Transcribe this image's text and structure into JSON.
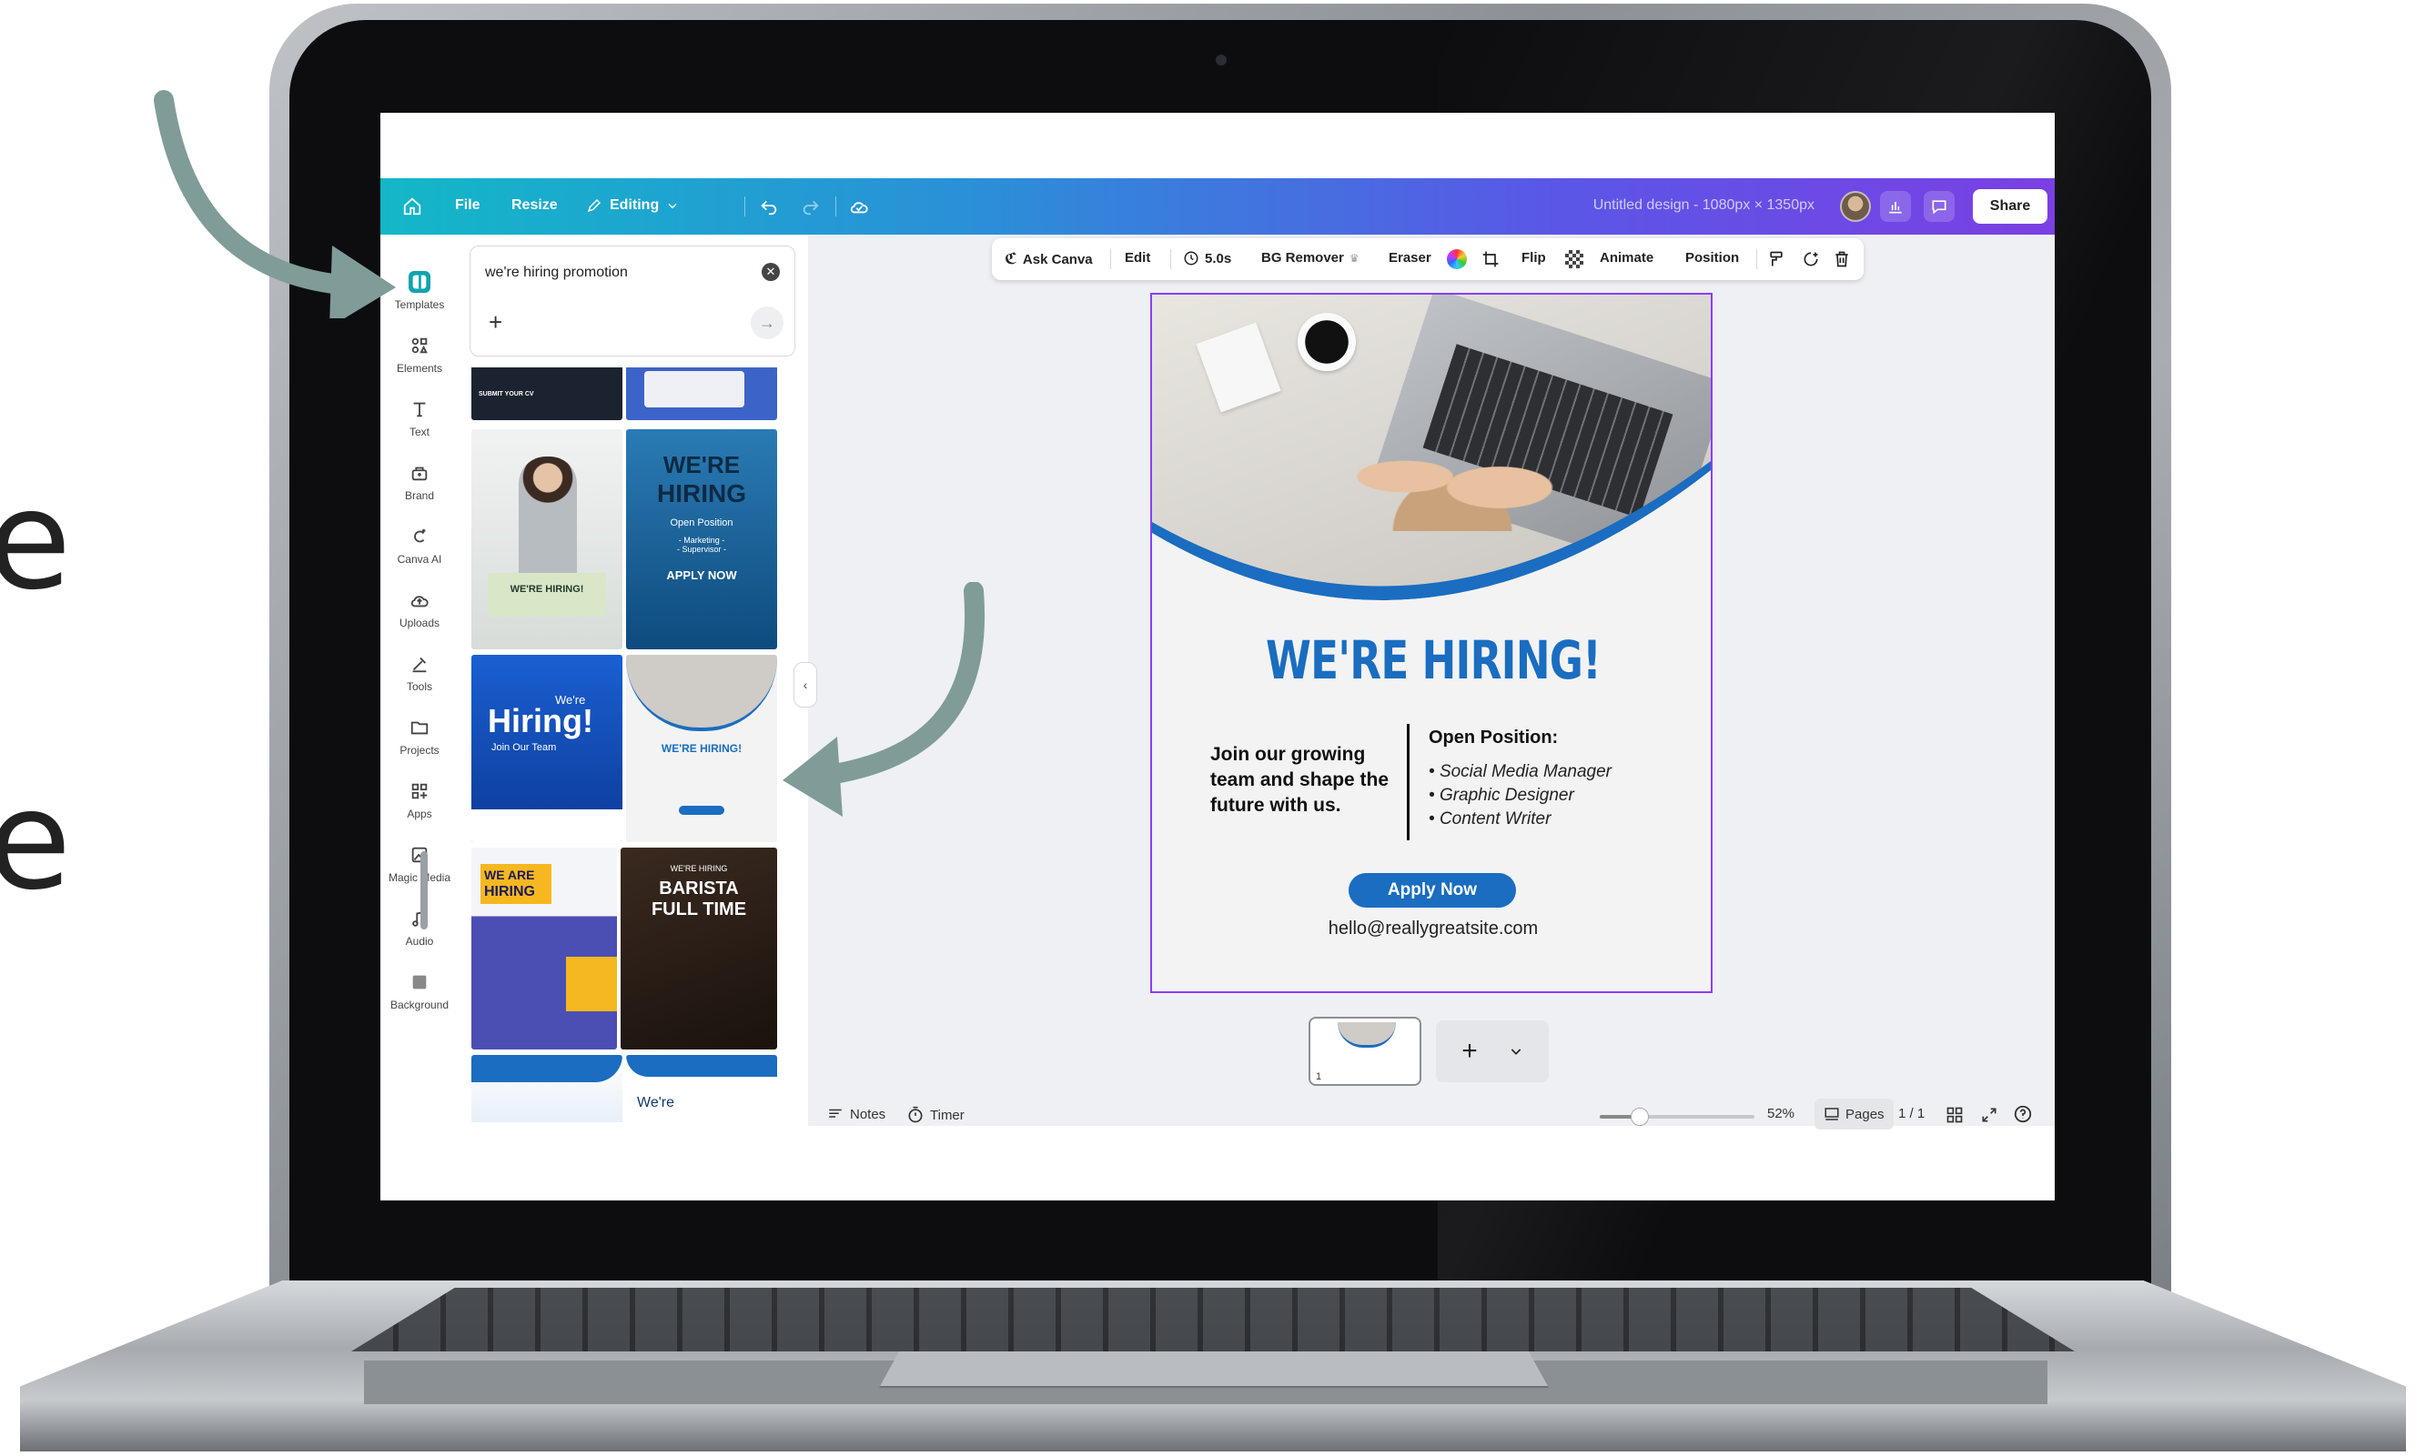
{
  "topbar": {
    "file": "File",
    "resize": "Resize",
    "editing": "Editing",
    "title": "Untitled design - 1080px × 1350px",
    "share": "Share"
  },
  "rail": [
    {
      "label": "Templates",
      "icon": "templates-icon"
    },
    {
      "label": "Elements",
      "icon": "elements-icon"
    },
    {
      "label": "Text",
      "icon": "text-icon"
    },
    {
      "label": "Brand",
      "icon": "brand-icon"
    },
    {
      "label": "Canva AI",
      "icon": "canva-ai-icon"
    },
    {
      "label": "Uploads",
      "icon": "uploads-icon"
    },
    {
      "label": "Tools",
      "icon": "tools-icon"
    },
    {
      "label": "Projects",
      "icon": "projects-icon"
    },
    {
      "label": "Apps",
      "icon": "apps-icon"
    },
    {
      "label": "Magic Media",
      "icon": "magic-media-icon"
    },
    {
      "label": "Audio",
      "icon": "audio-icon"
    },
    {
      "label": "Background",
      "icon": "background-icon"
    }
  ],
  "search": {
    "value": "we're hiring promotion"
  },
  "templates": [
    {
      "lines": [
        "SUBMIT YOUR CV"
      ]
    },
    {
      "lines": []
    },
    {
      "lines": [
        "WE'RE HIRING!"
      ]
    },
    {
      "lines": [
        "WE'RE",
        "HIRING",
        "Open Position",
        "- Marketing -",
        "- Supervisor -",
        "APPLY NOW"
      ]
    },
    {
      "lines": [
        "We're",
        "Hiring!",
        "Join Our Team"
      ]
    },
    {
      "lines": [
        "WE'RE HIRING!"
      ]
    },
    {
      "lines": [
        "WE ARE",
        "HIRING"
      ]
    },
    {
      "lines": [
        "WE'RE HIRING",
        "BARISTA",
        "FULL TIME"
      ]
    },
    {
      "lines": []
    },
    {
      "lines": [
        "We're"
      ]
    }
  ],
  "context_toolbar": {
    "ask_canva": "Ask Canva",
    "edit": "Edit",
    "duration": "5.0s",
    "bg_remover": "BG Remover",
    "eraser": "Eraser",
    "flip": "Flip",
    "animate": "Animate",
    "position": "Position"
  },
  "design": {
    "title": "WE'RE HIRING!",
    "join": "Join our growing team and shape the future with us.",
    "open_position": "Open Position:",
    "positions": [
      "Social Media Manager",
      "Graphic Designer",
      "Content Writer"
    ],
    "apply": "Apply Now",
    "email": "hello@reallygreatsite.com"
  },
  "pages": {
    "thumb_number": "1",
    "add": "+",
    "count": "1 / 1",
    "label": "Pages"
  },
  "footer": {
    "notes": "Notes",
    "timer": "Timer",
    "zoom": "52%",
    "zoom_level": 0.52
  },
  "edge_letters": [
    "e",
    "e"
  ],
  "colors": {
    "accent_teal": "#13b7c8",
    "accent_purple": "#7b3fe4",
    "design_blue": "#1a6dc0",
    "arrow": "#7f9c99",
    "selection": "#8b3dff"
  }
}
